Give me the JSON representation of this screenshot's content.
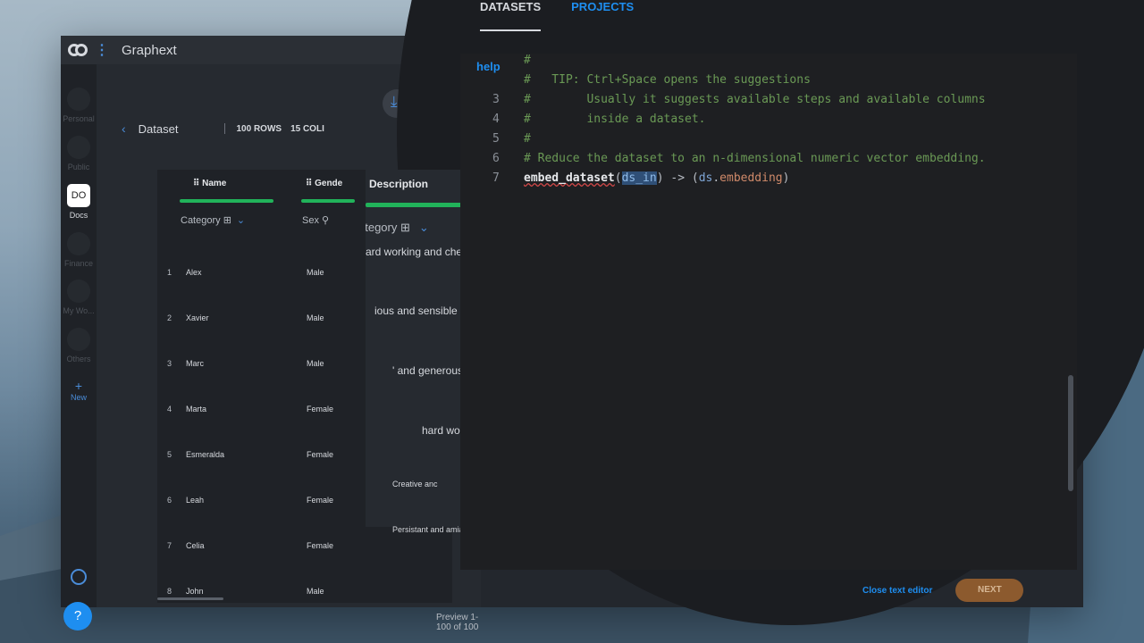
{
  "app": {
    "title": "Graphext"
  },
  "nav": {
    "items": [
      {
        "label": "Personal"
      },
      {
        "label": "Public"
      },
      {
        "label": "Docs",
        "badge": "DO"
      },
      {
        "label": "Finance"
      },
      {
        "label": "My Wo..."
      },
      {
        "label": "Others"
      },
      {
        "label": "New",
        "icon": "+"
      }
    ],
    "help": "?"
  },
  "dataset": {
    "title": "Dataset",
    "rows_label": "100 ROWS",
    "cols_label": "15 COLI",
    "columns": [
      {
        "name": "Name",
        "category": "Category"
      },
      {
        "name": "Gende",
        "category": "Sex"
      }
    ],
    "description": {
      "header": "Description",
      "category": "ategory"
    },
    "rows": [
      {
        "idx": "1",
        "name": "Alex",
        "gender": "Male",
        "desc": ""
      },
      {
        "idx": "2",
        "name": "Xavier",
        "gender": "Male",
        "desc": ""
      },
      {
        "idx": "3",
        "name": "Marc",
        "gender": "Male",
        "desc": ""
      },
      {
        "idx": "4",
        "name": "Marta",
        "gender": "Female",
        "desc": ""
      },
      {
        "idx": "5",
        "name": "Esmeralda",
        "gender": "Female",
        "desc": ""
      },
      {
        "idx": "6",
        "name": "Leah",
        "gender": "Female",
        "desc": ""
      },
      {
        "idx": "7",
        "name": "Celia",
        "gender": "Female",
        "desc": "Creative anc"
      },
      {
        "idx": "8",
        "name": "John",
        "gender": "Male",
        "desc": "Persistant and amiable"
      }
    ],
    "desc_fragments": [
      "ard working and chee",
      "ious and sensible",
      "' and generous",
      "hard worl"
    ],
    "preview": "Preview 1-100 of 100"
  },
  "tabs": [
    {
      "label": "DATASETS",
      "active": true
    },
    {
      "label": "PROJECTS",
      "active": false
    }
  ],
  "editor": {
    "help": "help",
    "lines": [
      {
        "no": "",
        "text": "#"
      },
      {
        "no": "",
        "text": "#   TIP: Ctrl+Space opens the suggestions"
      },
      {
        "no": "3",
        "text": "#        Usually it suggests available steps and available columns"
      },
      {
        "no": "4",
        "text": "#        inside a dataset."
      },
      {
        "no": "5",
        "text": "#"
      },
      {
        "no": "6",
        "text": "# Reduce the dataset to an n-dimensional numeric vector embedding."
      },
      {
        "no": "7",
        "fn": "embed_dataset",
        "arg": "ds_in",
        "out_ds": "ds",
        "out_field": "embedding"
      }
    ],
    "close_label": "Close text editor",
    "next_label": "NEXT"
  }
}
